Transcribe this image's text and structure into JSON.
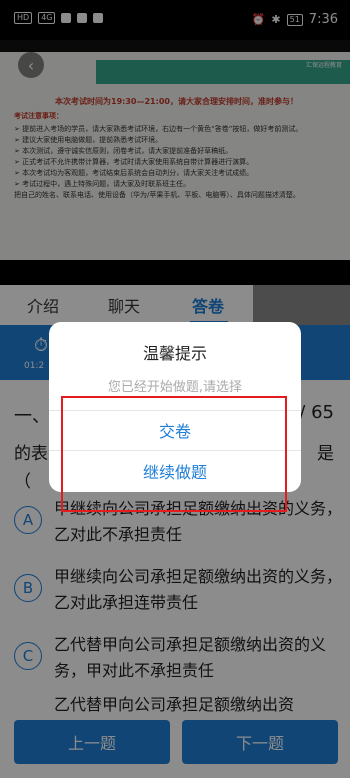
{
  "status_bar": {
    "left_chips": [
      "HD",
      "4G"
    ],
    "battery": "51",
    "time": "7:36"
  },
  "video": {
    "slide_logo": "汇保远程教育",
    "slide_title": "本次考试时间为19:30—21:00，请大家合理安排时间，准时参与！",
    "slide_subtitle": "考试注意事项：",
    "lines": [
      "➢ 提前进入考场的学员，请大家熟悉考试环境，右边有一个黄色“答卷”按钮，做好考前测试。",
      "➢ 建议大家使用电脑做题，提前熟悉考试环境。",
      "➢ 本次测试，遵守诚实信原则，闭卷考试，请大家提前准备好草稿纸。",
      "➢ 正式考试不允许携带计算器，考试时请大家使用系统自带计算器进行演算。",
      "➢ 本次考试均为客观题，考试结束后系统会自动判分，请大家关注考试成绩。",
      "➢ 考试过程中，遇上特殊问题，请大家及时联系班主任。",
      "   把自己的姓名、联系电话、使用设备（华为/苹果手机、平板、电脑等）、具体问题描述清楚。"
    ]
  },
  "tabs": [
    {
      "label": "介绍"
    },
    {
      "label": "聊天"
    },
    {
      "label": "答卷",
      "active": true
    }
  ],
  "timer": {
    "text": "01:2"
  },
  "question": {
    "type": "一、",
    "count": "/ 65",
    "text_line1": "的表",
    "text_line1_end": "是",
    "text_line2": "（",
    "options": [
      {
        "letter": "A",
        "text": "甲继续向公司承担足额缴纳出资的义务，乙对此不承担责任"
      },
      {
        "letter": "B",
        "text": "甲继续向公司承担足额缴纳出资的义务，乙对此承担连带责任"
      },
      {
        "letter": "C",
        "text": "乙代替甲向公司承担足额缴纳出资的义务，甲对此不承担责任"
      },
      {
        "letter": "D",
        "text": "乙代替甲向公司承担足额缴纳出资"
      }
    ]
  },
  "buttons": {
    "prev": "上一题",
    "next": "下一题"
  },
  "dialog": {
    "title": "温馨提示",
    "message": "您已经开始做题,请选择",
    "submit": "交卷",
    "continue": "继续做题"
  },
  "colors": {
    "accent": "#1e7ed8",
    "annotation_red": "#e31d1d"
  }
}
